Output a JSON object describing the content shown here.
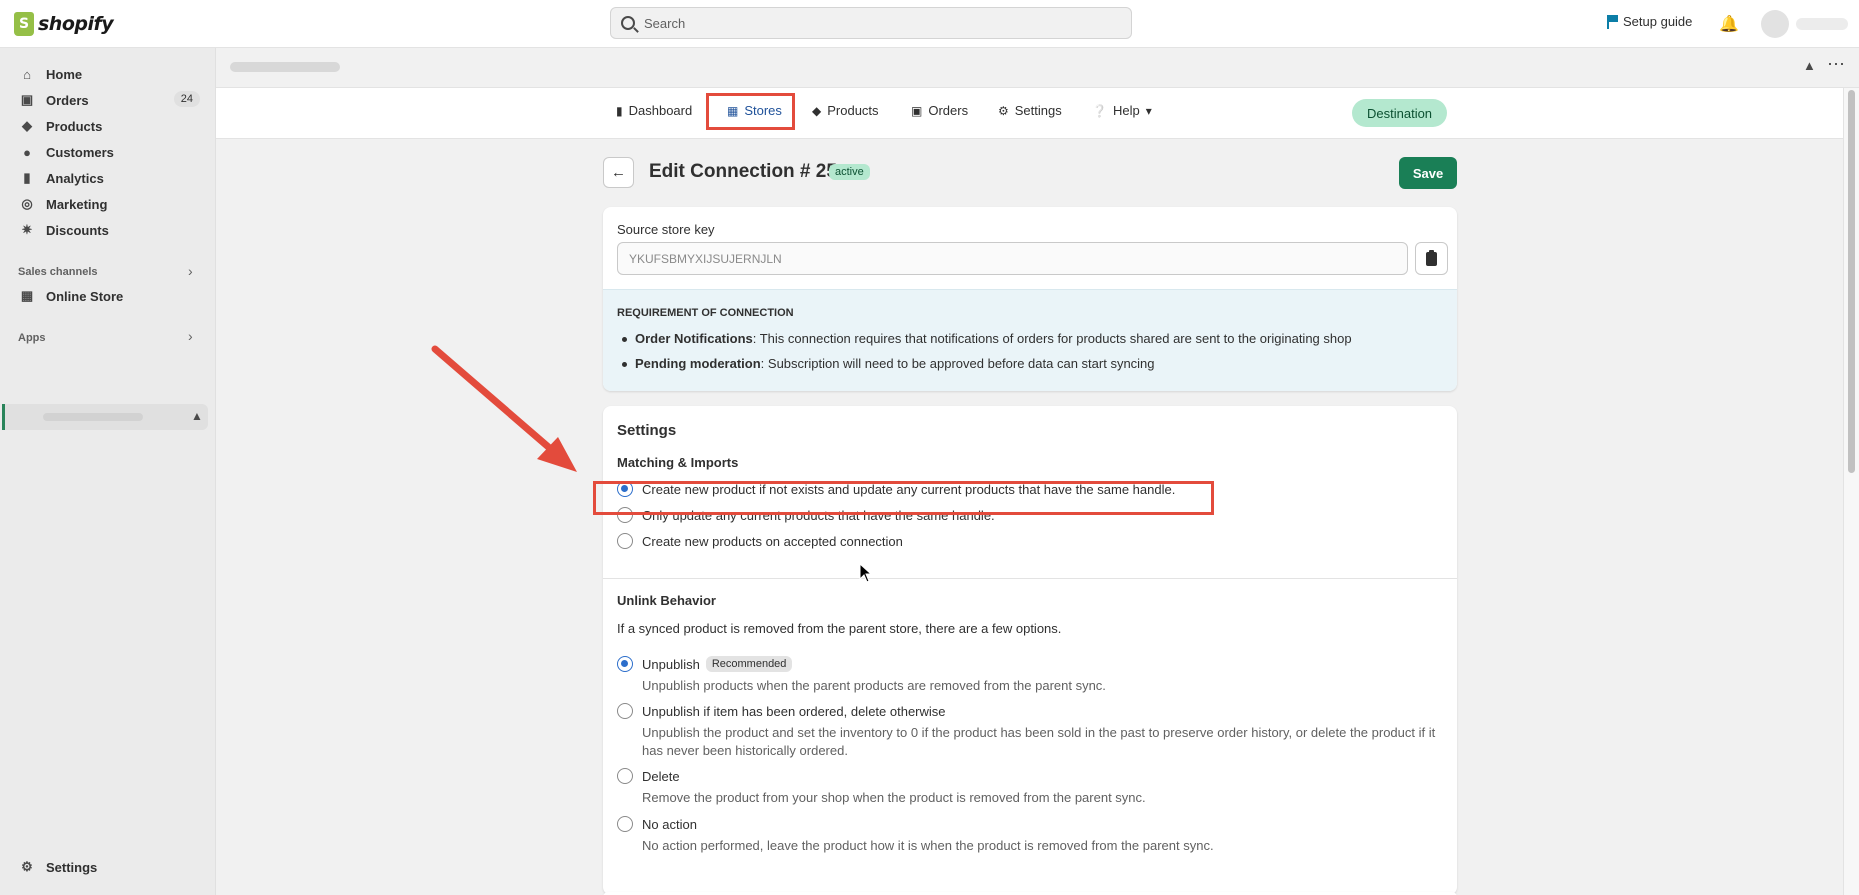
{
  "topbar": {
    "brand": "shopify",
    "search_placeholder": "Search",
    "setup_guide": "Setup guide"
  },
  "sidebar": {
    "items": [
      {
        "label": "Home",
        "icon": "home-icon"
      },
      {
        "label": "Orders",
        "icon": "inbox-icon",
        "badge": "24"
      },
      {
        "label": "Products",
        "icon": "tag-icon"
      },
      {
        "label": "Customers",
        "icon": "person-icon"
      },
      {
        "label": "Analytics",
        "icon": "bar-chart-icon"
      },
      {
        "label": "Marketing",
        "icon": "target-icon"
      },
      {
        "label": "Discounts",
        "icon": "discount-icon"
      }
    ],
    "sales_channels_label": "Sales channels",
    "online_store": "Online Store",
    "apps_label": "Apps",
    "settings": "Settings"
  },
  "app_nav": {
    "tabs": [
      {
        "label": "Dashboard",
        "icon": "bar-chart-icon"
      },
      {
        "label": "Stores",
        "icon": "store-icon",
        "active": true
      },
      {
        "label": "Products",
        "icon": "tag-icon"
      },
      {
        "label": "Orders",
        "icon": "inbox-icon"
      },
      {
        "label": "Settings",
        "icon": "gear-icon"
      },
      {
        "label": "Help",
        "icon": "question-icon"
      }
    ],
    "destination_badge": "Destination"
  },
  "page": {
    "title": "Edit Connection # 25",
    "status": "active",
    "save_label": "Save"
  },
  "source_key": {
    "label": "Source store key",
    "value": "YKUFSBMYXIJSUJERNJLN"
  },
  "requirement": {
    "title": "REQUIREMENT OF CONNECTION",
    "items": [
      {
        "term": "Order Notifications",
        "text": ": This connection requires that notifications of orders for products shared are sent to the originating shop"
      },
      {
        "term": "Pending moderation",
        "text": ": Subscription will need to be approved before data can start syncing"
      }
    ]
  },
  "settings": {
    "title": "Settings",
    "matching_title": "Matching & Imports",
    "matching_options": [
      {
        "label": "Create new product if not exists and update any current products that have the same handle.",
        "selected": true
      },
      {
        "label": "Only update any current products that have the same handle.",
        "selected": false
      },
      {
        "label": "Create new products on accepted connection",
        "selected": false
      }
    ],
    "unlink_title": "Unlink Behavior",
    "unlink_desc": "If a synced product is removed from the parent store, there are a few options.",
    "unlink_options": [
      {
        "label": "Unpublish",
        "badge": "Recommended",
        "help": "Unpublish products when the parent products are removed from the parent sync.",
        "selected": true
      },
      {
        "label": "Unpublish if item has been ordered, delete otherwise",
        "help": "Unpublish the product and set the inventory to 0 if the product has been sold in the past to preserve order history, or delete the product if it has never been historically ordered.",
        "selected": false
      },
      {
        "label": "Delete",
        "help": "Remove the product from your shop when the product is removed from the parent sync.",
        "selected": false
      },
      {
        "label": "No action",
        "help": "No action performed, leave the product how it is when the product is removed from the parent sync.",
        "selected": false
      }
    ]
  },
  "colors": {
    "accent": "#1a7f56",
    "annotation": "#e34b3c",
    "radio_selected": "#2c6ecb"
  }
}
